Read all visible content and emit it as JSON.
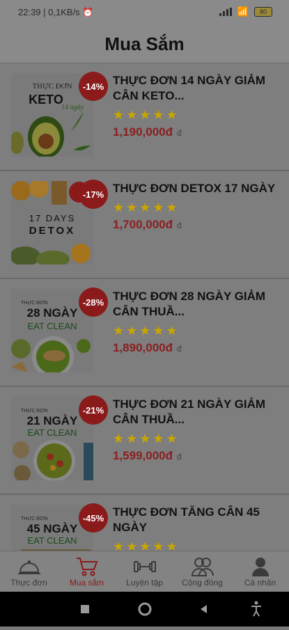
{
  "status": {
    "time": "22:39",
    "net": "0,1KB/s",
    "battery": "80"
  },
  "header": {
    "title": "Mua Sắm"
  },
  "products": [
    {
      "discount": "-14%",
      "title": "THỰC ĐƠN 14 NGÀY GIẢM CÂN KETO...",
      "stars": 5,
      "price": "1,190,000đ",
      "currency": "đ",
      "thumb": {
        "l1": "THỰC ĐƠN",
        "l2": "KETO",
        "l3": "14 ngày"
      }
    },
    {
      "discount": "-17%",
      "title": "THỰC ĐƠN DETOX 17 NGÀY",
      "stars": 5,
      "price": "1,700,000đ",
      "currency": "đ",
      "thumb": {
        "l1": "17 DAYS",
        "l2": "DETOX",
        "l3": ""
      }
    },
    {
      "discount": "-28%",
      "title": "THỰC ĐƠN 28 NGÀY GIẢM CÂN THUẦ...",
      "stars": 5,
      "price": "1,890,000đ",
      "currency": "đ",
      "thumb": {
        "l1": "THỰC ĐƠN",
        "l2": "28 NGÀY",
        "l3": "EAT CLEAN"
      }
    },
    {
      "discount": "-21%",
      "title": "THỰC ĐƠN 21 NGÀY GIẢM CÂN THUẦ...",
      "stars": 5,
      "price": "1,599,000đ",
      "currency": "đ",
      "thumb": {
        "l1": "THỰC ĐƠN",
        "l2": "21 NGÀY",
        "l3": "EAT CLEAN"
      }
    },
    {
      "discount": "-45%",
      "title": "THỰC ĐƠN TĂNG CÂN 45 NGÀY",
      "stars": 5,
      "price": "",
      "currency": "",
      "thumb": {
        "l1": "THỰC ĐƠN",
        "l2": "45 NGÀY",
        "l3": "EAT CLEAN"
      }
    }
  ],
  "tabs": [
    {
      "label": "Thực đơn",
      "icon": "cloche-icon",
      "active": false
    },
    {
      "label": "Mua sắm",
      "icon": "cart-icon",
      "active": true
    },
    {
      "label": "Luyện tập",
      "icon": "dumbbell-icon",
      "active": false
    },
    {
      "label": "Cộng đồng",
      "icon": "community-icon",
      "active": false
    },
    {
      "label": "Cá nhân",
      "icon": "person-icon",
      "active": false
    }
  ],
  "colors": {
    "accent": "#8b1a1a",
    "star": "#c9a600"
  }
}
